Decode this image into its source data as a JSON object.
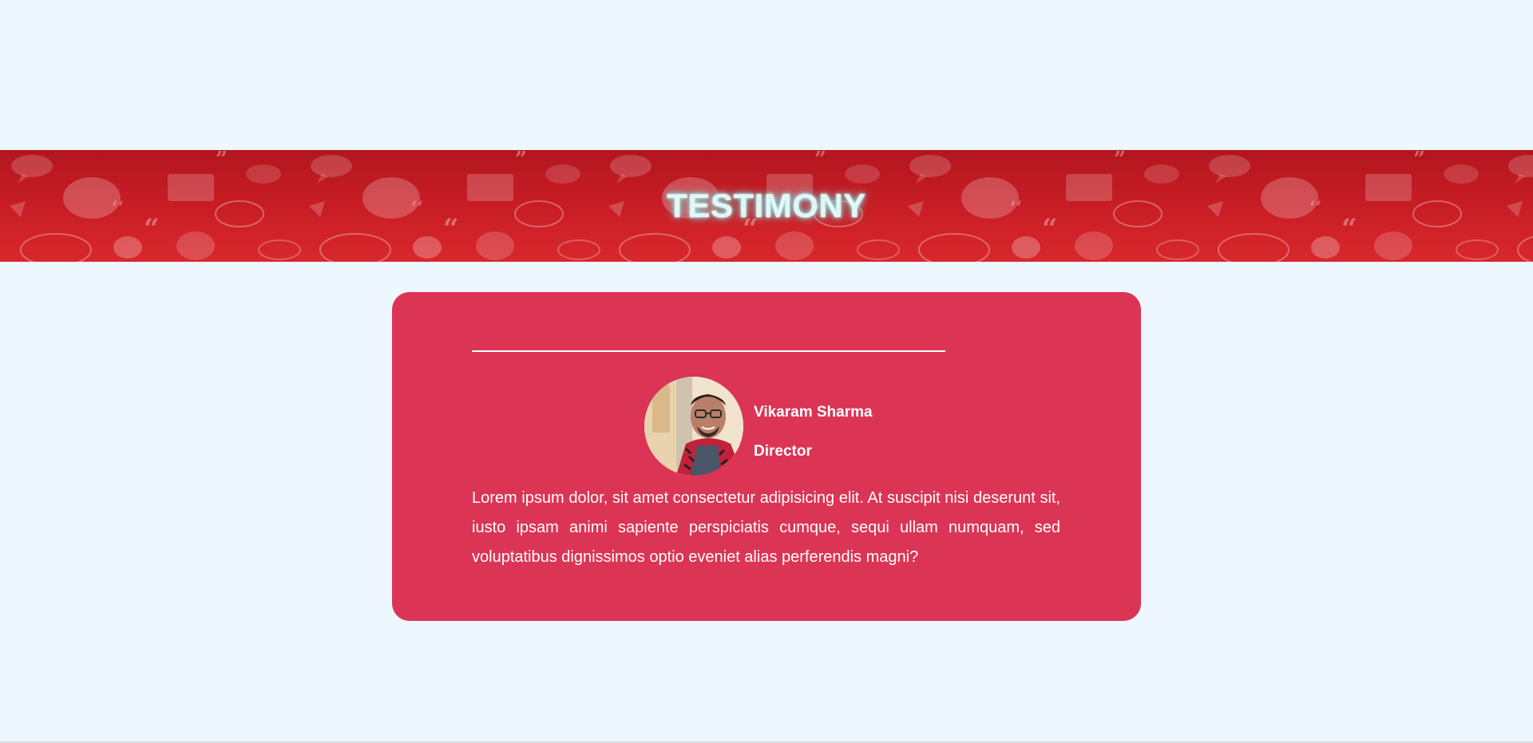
{
  "banner": {
    "title": "TESTIMONY"
  },
  "testimonial": {
    "name": "Vikaram Sharma",
    "role": "Director",
    "quote": "Lorem ipsum dolor, sit amet consectetur adipisicing elit. At suscipit nisi deserunt sit, iusto ipsam animi sapiente perspiciatis cumque, sequi ullam numquam, sed voluptatibus dignissimos optio eveniet alias perferendis magni?"
  },
  "colors": {
    "page_background": "#eef6fe",
    "banner_red": "#c81d25",
    "card_background": "#dc3455",
    "text_white": "#ffffff",
    "title_glow": "#8ff4f2"
  }
}
